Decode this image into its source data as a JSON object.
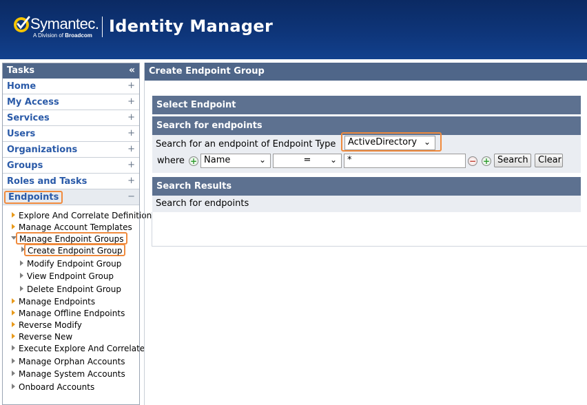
{
  "colors": {
    "header_bg": "#0e3579",
    "section_bar": "#4f6689",
    "link": "#2a5aa8",
    "highlight": "#f08a3c",
    "arrow_active": "#e89a1b"
  },
  "header": {
    "brand": "Symantec.",
    "tagline_prefix": "A Division of ",
    "tagline_brand": "Broadcom",
    "product": "Identity Manager"
  },
  "sidebar": {
    "title": "Tasks",
    "collapse_icon": "«",
    "categories": [
      {
        "label": "Home",
        "icon": "+"
      },
      {
        "label": "My Access",
        "icon": "+"
      },
      {
        "label": "Services",
        "icon": "+"
      },
      {
        "label": "Users",
        "icon": "+"
      },
      {
        "label": "Organizations",
        "icon": "+"
      },
      {
        "label": "Groups",
        "icon": "+"
      },
      {
        "label": "Roles and Tasks",
        "icon": "+"
      },
      {
        "label": "Endpoints",
        "icon": "−"
      }
    ],
    "tree": [
      {
        "label": "Explore And Correlate Definition"
      },
      {
        "label": "Manage Account Templates"
      },
      {
        "label": "Manage Endpoint Groups"
      },
      {
        "label": "Create Endpoint Group"
      },
      {
        "label": "Modify Endpoint Group"
      },
      {
        "label": "View Endpoint Group"
      },
      {
        "label": "Delete Endpoint Group"
      },
      {
        "label": "Manage Endpoints"
      },
      {
        "label": "Manage Offline Endpoints"
      },
      {
        "label": "Reverse Modify"
      },
      {
        "label": "Reverse New"
      },
      {
        "label": "Execute Explore And Correlate"
      },
      {
        "label": "Manage Orphan Accounts"
      },
      {
        "label": "Manage System Accounts"
      },
      {
        "label": "Onboard Accounts"
      }
    ]
  },
  "main": {
    "title": "Create Endpoint Group",
    "select_endpoint": "Select Endpoint",
    "search_header": "Search for endpoints",
    "search_prompt": "Search for an endpoint of Endpoint Type",
    "endpoint_type": "ActiveDirectory",
    "where_label": "where",
    "attribute": "Name",
    "operator": "=",
    "value": "*",
    "search_button": "Search",
    "clear_button": "Clear",
    "results_header": "Search Results",
    "results_text": "Search for endpoints"
  }
}
